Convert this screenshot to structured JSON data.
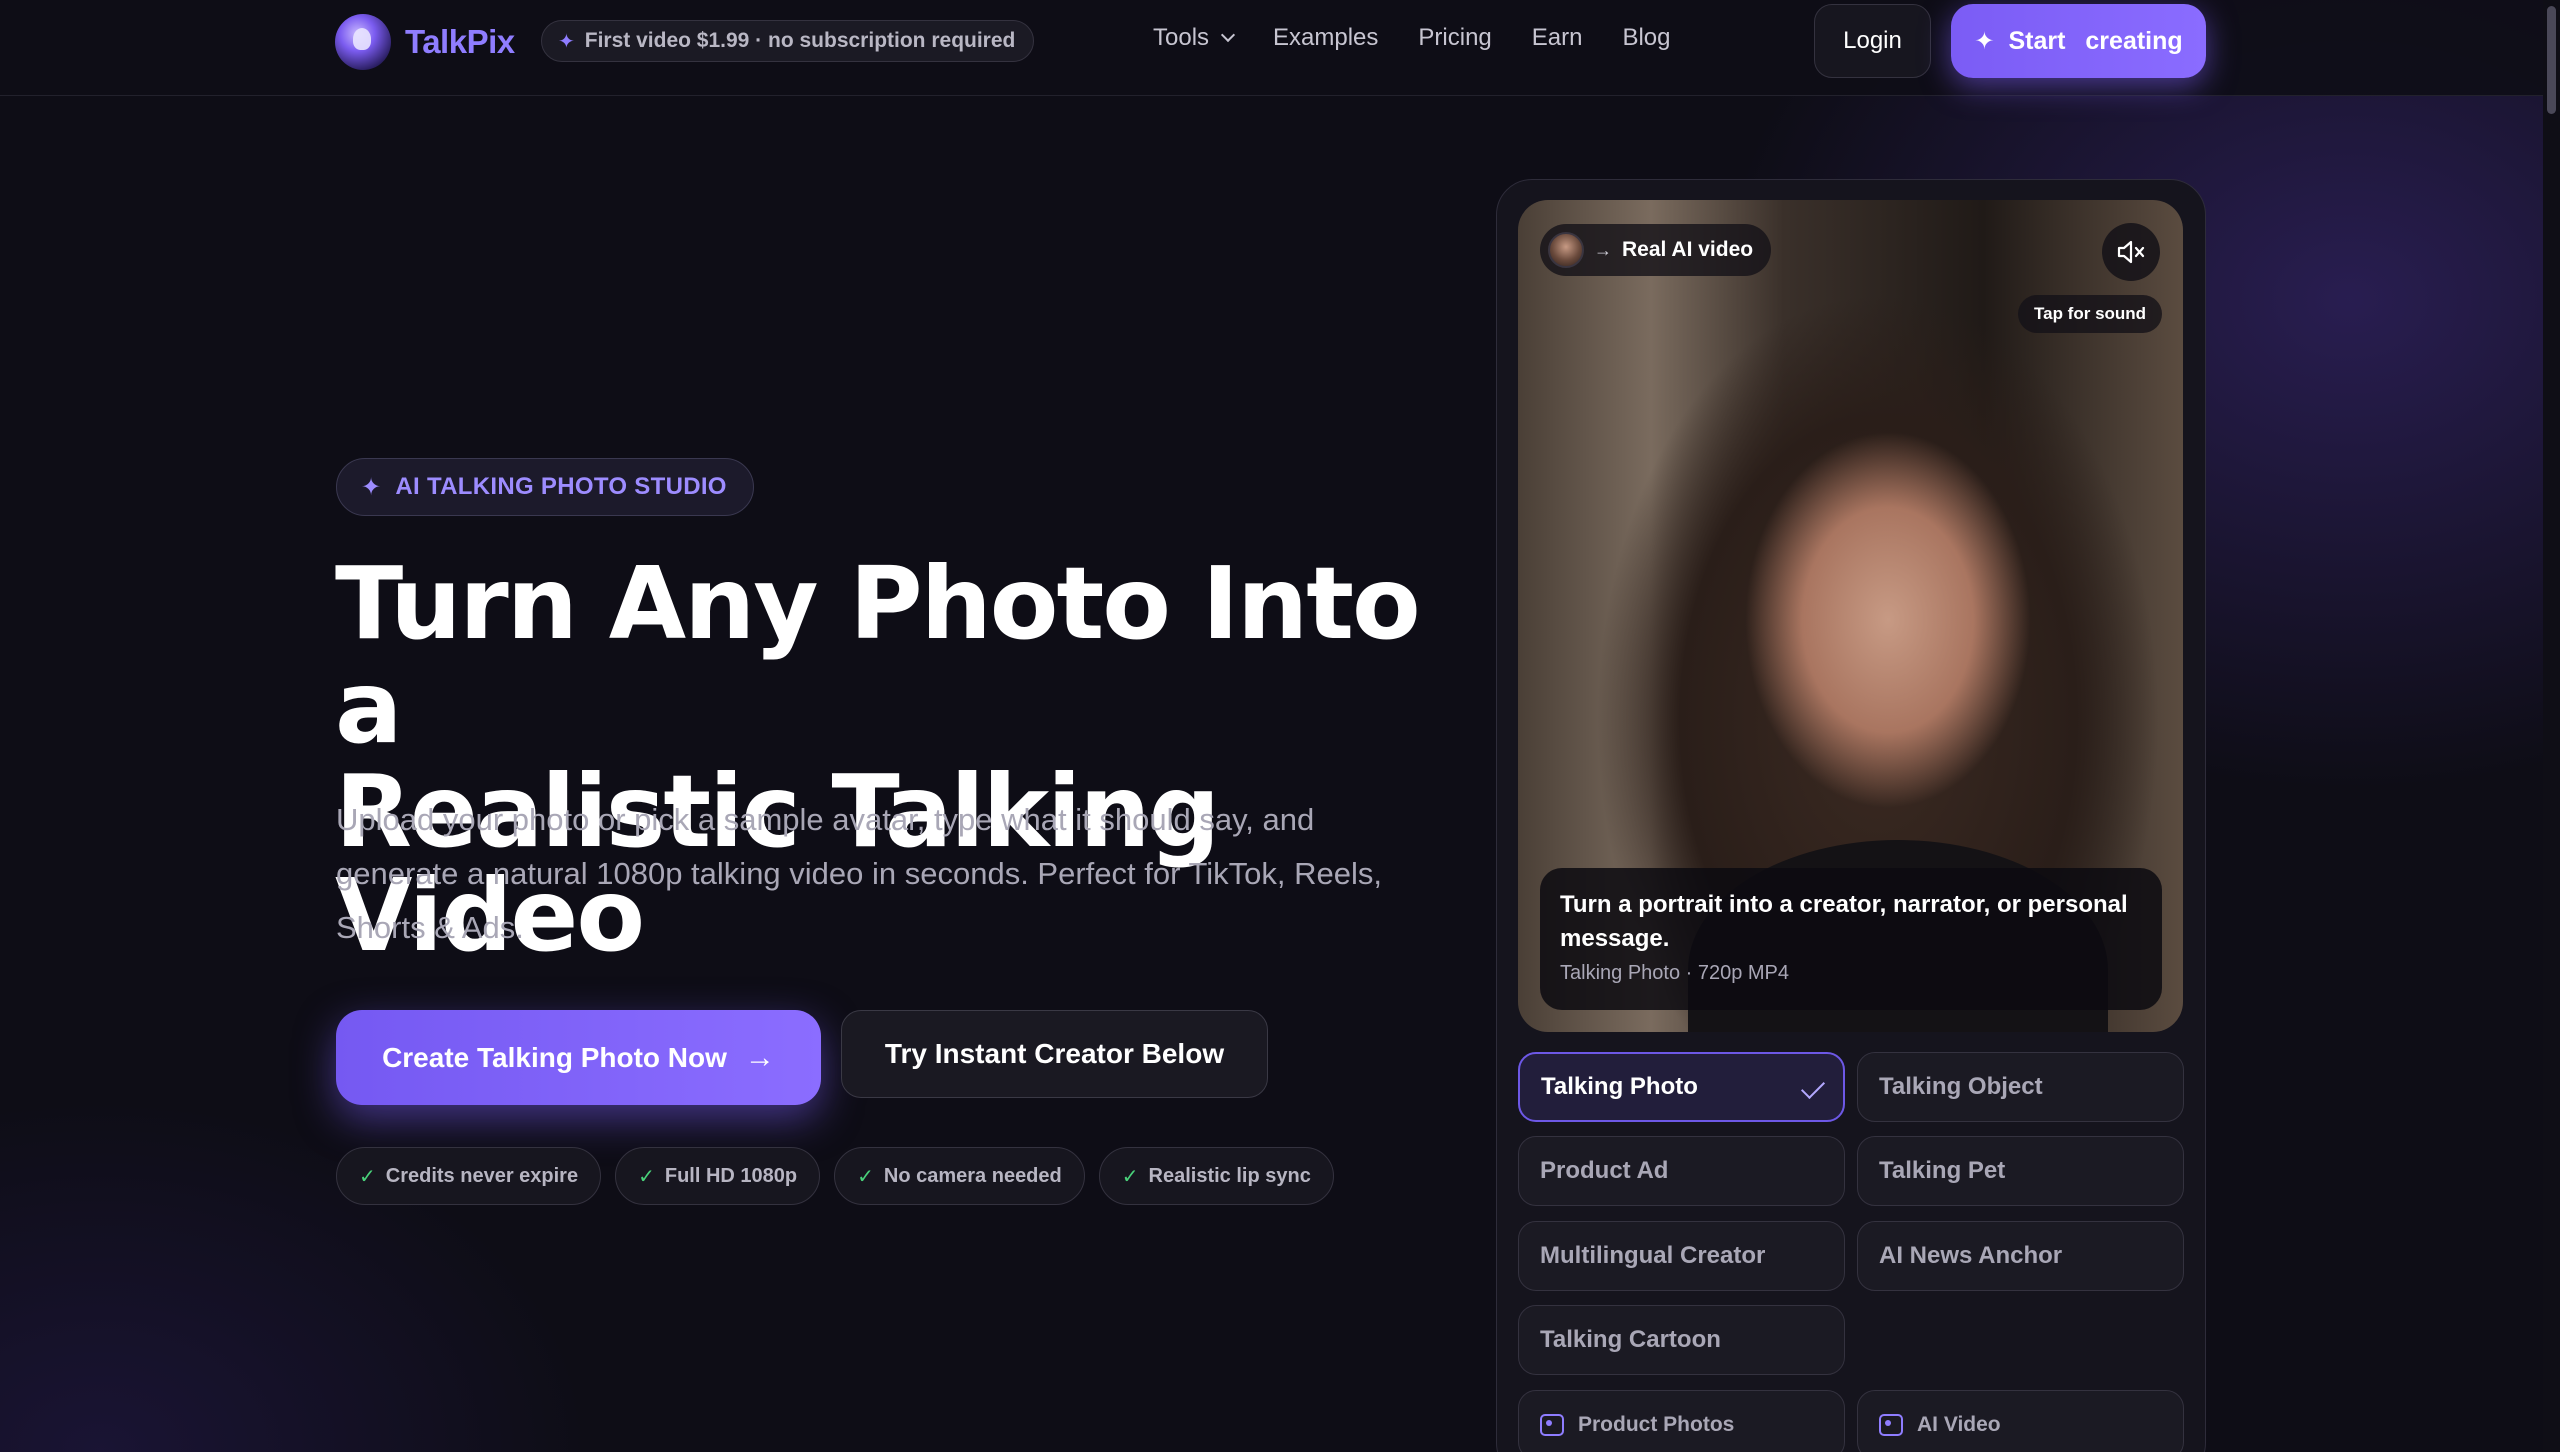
{
  "nav": {
    "brand": "TalkPix",
    "promo": "First video $1.99 · no subscription required",
    "links": [
      {
        "label": "Tools"
      },
      {
        "label": "Examples"
      },
      {
        "label": "Pricing"
      },
      {
        "label": "Earn"
      },
      {
        "label": "Blog"
      }
    ],
    "login": "Login",
    "start_word1": "Start",
    "start_word2": "creating"
  },
  "hero": {
    "badge": "AI TALKING PHOTO STUDIO",
    "headline_line1": "Turn Any Photo Into a",
    "headline_line2": "Realistic Talking Video",
    "subtitle": "Upload your photo or pick a sample avatar, type what it should say, and generate a natural 1080p talking video in seconds. Perfect for TikTok, Reels, Shorts & Ads.",
    "cta_primary": "Create Talking Photo Now",
    "cta_secondary": "Try Instant Creator Below",
    "features": [
      "Credits never expire",
      "Full HD 1080p",
      "No camera needed",
      "Realistic lip sync"
    ]
  },
  "preview": {
    "pill": "Real AI video",
    "tap_for_sound": "Tap for sound",
    "caption_title": "Turn a portrait into a creator, narrator, or personal message.",
    "caption_meta": "Talking Photo · 720p MP4",
    "options": [
      {
        "label": "Talking Photo",
        "selected": true
      },
      {
        "label": "Talking Object",
        "selected": false
      },
      {
        "label": "Product Ad",
        "selected": false
      },
      {
        "label": "Talking Pet",
        "selected": false
      },
      {
        "label": "Multilingual Creator",
        "selected": false
      },
      {
        "label": "AI News Anchor",
        "selected": false
      },
      {
        "label": "Talking Cartoon",
        "selected": false
      }
    ],
    "tools": [
      {
        "label": "Product Photos",
        "icon": "image-icon"
      },
      {
        "label": "AI Video",
        "icon": "clapper-icon"
      }
    ]
  },
  "colors": {
    "accent": "#7b5cf5",
    "brand": "#8f7dff",
    "background": "#0e0d16",
    "check": "#49d17a"
  }
}
